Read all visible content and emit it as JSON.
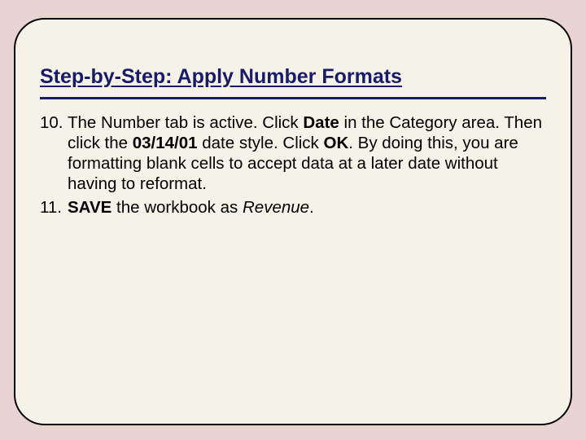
{
  "title": "Step-by-Step: Apply Number Formats",
  "steps": [
    {
      "num": "10.",
      "segments": [
        {
          "t": "The Number tab is active. Click "
        },
        {
          "t": "Date",
          "b": true
        },
        {
          "t": " in the Category area. Then click the "
        },
        {
          "t": "03/14/01",
          "b": true
        },
        {
          "t": " date style. Click "
        },
        {
          "t": "OK",
          "b": true
        },
        {
          "t": ". By doing this, you are formatting blank cells to accept data at a later date without having to reformat."
        }
      ]
    },
    {
      "num": "11.",
      "segments": [
        {
          "t": "SAVE",
          "b": true
        },
        {
          "t": " the workbook as "
        },
        {
          "t": "Revenue",
          "i": true
        },
        {
          "t": "."
        }
      ]
    }
  ]
}
